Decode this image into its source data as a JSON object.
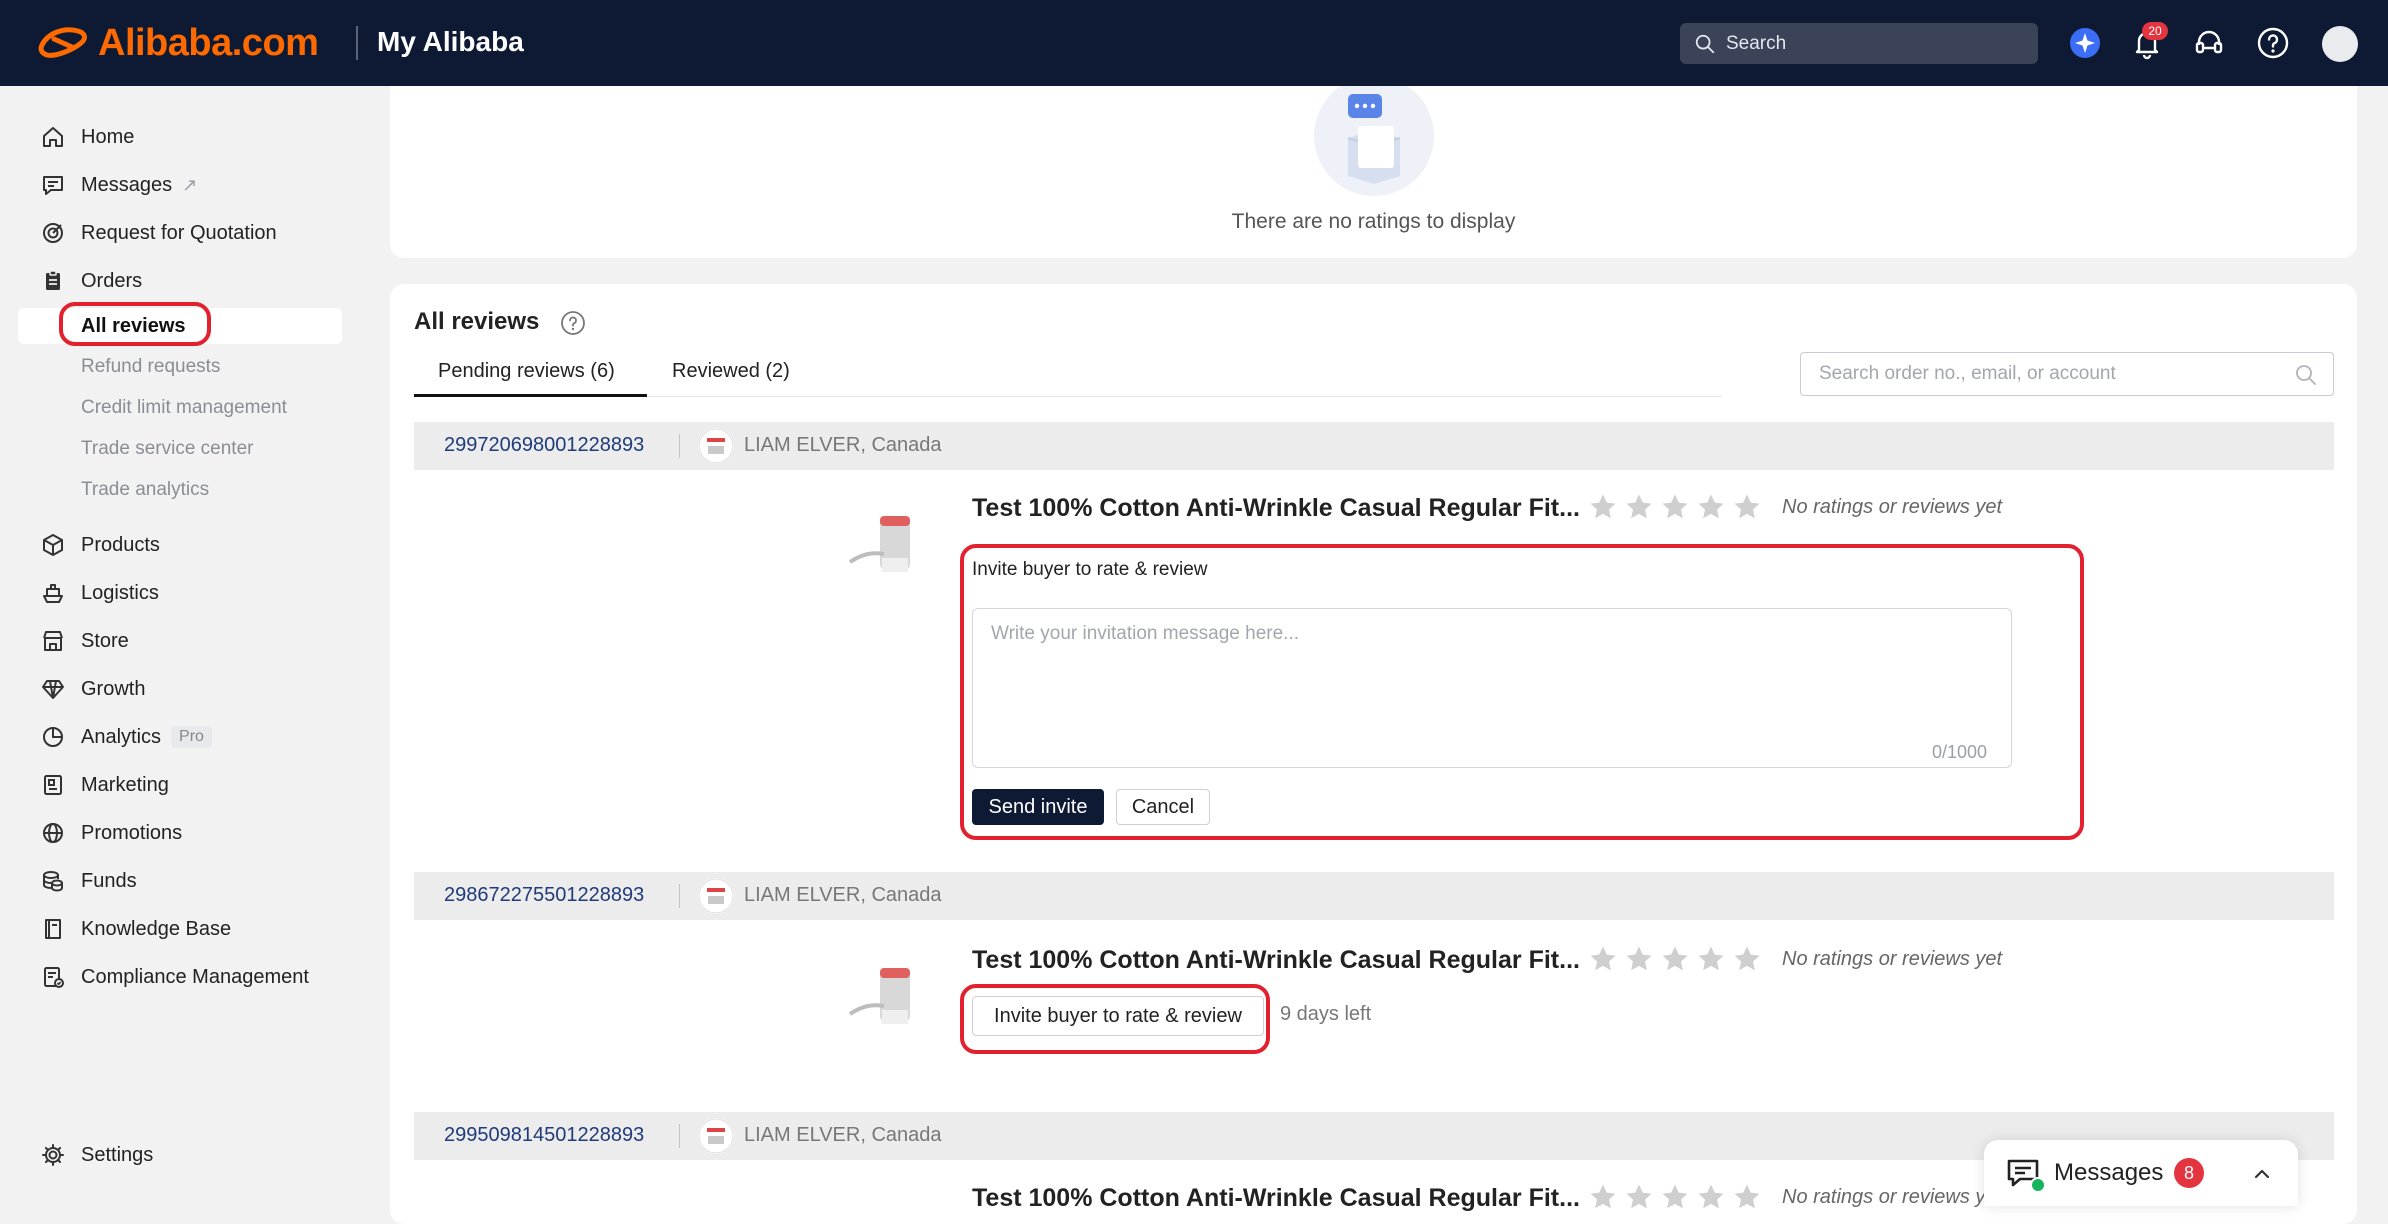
{
  "header": {
    "brand": "Alibaba.com",
    "app_title": "My Alibaba",
    "search_label": "Search",
    "notification_count": "20"
  },
  "sidebar": {
    "home": "Home",
    "messages": "Messages",
    "rfq": "Request for Quotation",
    "orders": "Orders",
    "orders_sub": {
      "all_reviews": "All reviews",
      "refund_requests": "Refund requests",
      "credit_limit": "Credit limit management",
      "trade_service": "Trade service center",
      "trade_analytics": "Trade analytics"
    },
    "products": "Products",
    "logistics": "Logistics",
    "store": "Store",
    "growth": "Growth",
    "analytics": "Analytics",
    "analytics_tag": "Pro",
    "marketing": "Marketing",
    "promotions": "Promotions",
    "funds": "Funds",
    "knowledge_base": "Knowledge Base",
    "compliance": "Compliance Management",
    "settings": "Settings"
  },
  "ratings": {
    "empty_text": "There are no ratings to display"
  },
  "reviews": {
    "title": "All reviews",
    "tabs": {
      "pending": "Pending reviews (6)",
      "reviewed": "Reviewed (2)"
    },
    "search_placeholder": "Search order no., email, or account",
    "orders": [
      {
        "order_no": "299720698001228893",
        "buyer": "LIAM ELVER, Canada",
        "product_title": "Test 100% Cotton Anti-Wrinkle Casual Regular Fit...",
        "rating_status": "No ratings or reviews yet"
      },
      {
        "order_no": "298672275501228893",
        "buyer": "LIAM ELVER, Canada",
        "product_title": "Test 100% Cotton Anti-Wrinkle Casual Regular Fit...",
        "rating_status": "No ratings or reviews yet",
        "invite_button": "Invite buyer to rate & review",
        "days_left": "9 days left"
      },
      {
        "order_no": "299509814501228893",
        "buyer": "LIAM ELVER, Canada",
        "product_title": "Test 100% Cotton Anti-Wrinkle Casual Regular Fit...",
        "rating_status": "No ratings or reviews yet"
      }
    ],
    "invite_form": {
      "label": "Invite buyer to rate & review",
      "placeholder": "Write your invitation message here...",
      "char_count": "0/1000",
      "send_label": "Send invite",
      "cancel_label": "Cancel"
    }
  },
  "messages_float": {
    "label": "Messages",
    "count": "8"
  },
  "colors": {
    "header_bg": "#0e1a33",
    "brand_orange": "#ff6a00",
    "highlight_red": "#e3202d",
    "badge_red": "#e4343f",
    "link_blue": "#1f3b7a"
  }
}
